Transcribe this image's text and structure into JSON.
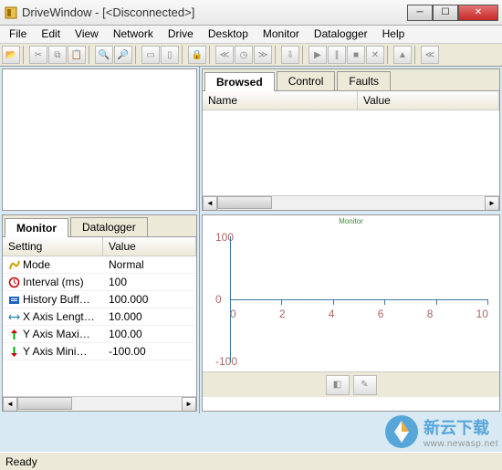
{
  "window": {
    "title": "DriveWindow - [<Disconnected>]"
  },
  "menu": [
    "File",
    "Edit",
    "View",
    "Network",
    "Drive",
    "Desktop",
    "Monitor",
    "Datalogger",
    "Help"
  ],
  "toolbar": {
    "groups": [
      [
        "open"
      ],
      [
        "cut",
        "copy",
        "paste"
      ],
      [
        "zoom-in",
        "zoom-out"
      ],
      [
        "window1",
        "window2"
      ],
      [
        "lock"
      ],
      [
        "prev-fast",
        "clock",
        "next-fast"
      ],
      [
        "download"
      ],
      [
        "play",
        "pause",
        "stop",
        "cancel"
      ],
      [
        "up"
      ],
      [
        "rewind"
      ]
    ]
  },
  "right_tabs": {
    "items": [
      "Browsed",
      "Control",
      "Faults"
    ],
    "active": 0,
    "columns": [
      "Name",
      "Value"
    ]
  },
  "left_tabs": {
    "items": [
      "Monitor",
      "Datalogger"
    ],
    "active": 0,
    "columns": [
      "Setting",
      "Value"
    ],
    "rows": [
      {
        "icon": "mode-icon",
        "setting": "Mode",
        "value": "Normal"
      },
      {
        "icon": "interval-icon",
        "setting": "Interval (ms)",
        "value": "100"
      },
      {
        "icon": "history-icon",
        "setting": "History Buff…",
        "value": "100.000"
      },
      {
        "icon": "xaxis-icon",
        "setting": "X Axis Lengt…",
        "value": "10.000"
      },
      {
        "icon": "ymax-icon",
        "setting": "Y Axis Maxi…",
        "value": "100.00"
      },
      {
        "icon": "ymin-icon",
        "setting": "Y Axis Mini…",
        "value": "-100.00"
      }
    ]
  },
  "chart_data": {
    "type": "line",
    "title": "Monitor",
    "xlabel": "",
    "ylabel": "",
    "ylim": [
      -100,
      100
    ],
    "xlim": [
      0,
      10
    ],
    "yticks": [
      100,
      0,
      -100
    ],
    "xticks": [
      0.0,
      2.0,
      4.0,
      6.0,
      8.0,
      10.0
    ],
    "series": []
  },
  "status": {
    "text": "Ready"
  },
  "watermark": {
    "cn": "新云下载",
    "url": "www.newasp.net"
  }
}
